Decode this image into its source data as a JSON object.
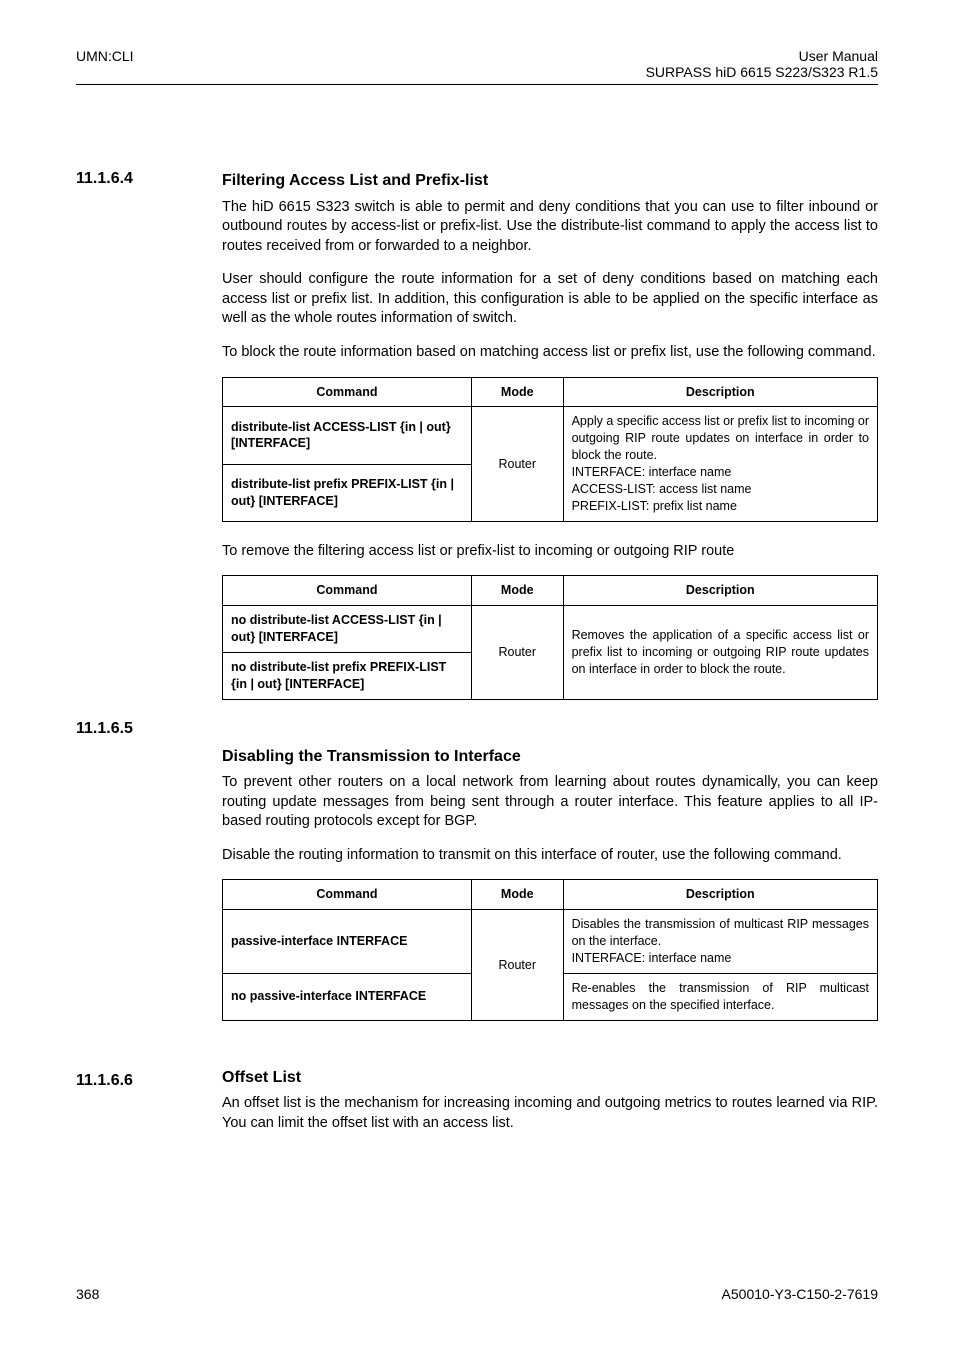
{
  "header": {
    "left": "UMN:CLI",
    "right_top": "User Manual",
    "right_bottom": "SURPASS hiD 6615 S223/S323 R1.5"
  },
  "sec1": {
    "num": "11.1.6.4",
    "title": "Filtering Access List and Prefix-list",
    "p1": "The hiD 6615 S323 switch is able to permit and deny conditions that you can use to filter inbound or outbound routes by access-list or prefix-list. Use the distribute-list command to apply the access list to routes received from or forwarded to a neighbor.",
    "p2": "User should configure the route information for a set of deny conditions based on matching each access list or prefix list. In addition, this configuration is able to be applied on the specific interface as well as the whole routes information of switch.",
    "p3": "To block the route information based on matching access list or prefix list, use the following command.",
    "thead": {
      "c": "Command",
      "m": "Mode",
      "d": "Description"
    },
    "r1c": "distribute-list ACCESS-LIST {in | out} [INTERFACE]",
    "r2c": "distribute-list prefix PREFIX-LIST {in | out} [INTERFACE]",
    "mode": "Router",
    "desc": "Apply a specific access list or prefix list to incoming or outgoing RIP route updates on interface in order to block the route.\nINTERFACE: interface name\nACCESS-LIST: access list name\nPREFIX-LIST: prefix list name",
    "p4": "To remove the filtering access list or prefix-list to incoming or outgoing RIP route",
    "r3c": "no distribute-list ACCESS-LIST {in | out} [INTERFACE]",
    "r4c": "no distribute-list prefix PREFIX-LIST {in | out} [INTERFACE]",
    "desc2": "Removes the application of a specific access list or prefix list to incoming or outgoing RIP route updates on interface in order to block the route."
  },
  "sec2": {
    "num": "11.1.6.5",
    "title": "Disabling the Transmission to Interface",
    "p1": "To prevent other routers on a local network from learning about routes dynamically, you can keep routing update messages from being sent through a router interface. This feature applies to all IP-based routing protocols except for BGP.",
    "p2": "Disable the routing information to transmit on this interface of router, use the following command.",
    "r1c": "passive-interface INTERFACE",
    "d1": "Disables the transmission of multicast RIP messages on the interface.\nINTERFACE: interface name",
    "r2c": "no passive-interface INTERFACE",
    "d2": "Re-enables the transmission of RIP multicast messages on the specified interface."
  },
  "sec3": {
    "num": "11.1.6.6",
    "title": "Offset List",
    "p1": "An offset list is the mechanism for increasing incoming and outgoing metrics to routes learned via RIP. You can limit the offset list with an access list."
  },
  "footer": {
    "left": "368",
    "right": "A50010-Y3-C150-2-7619"
  }
}
